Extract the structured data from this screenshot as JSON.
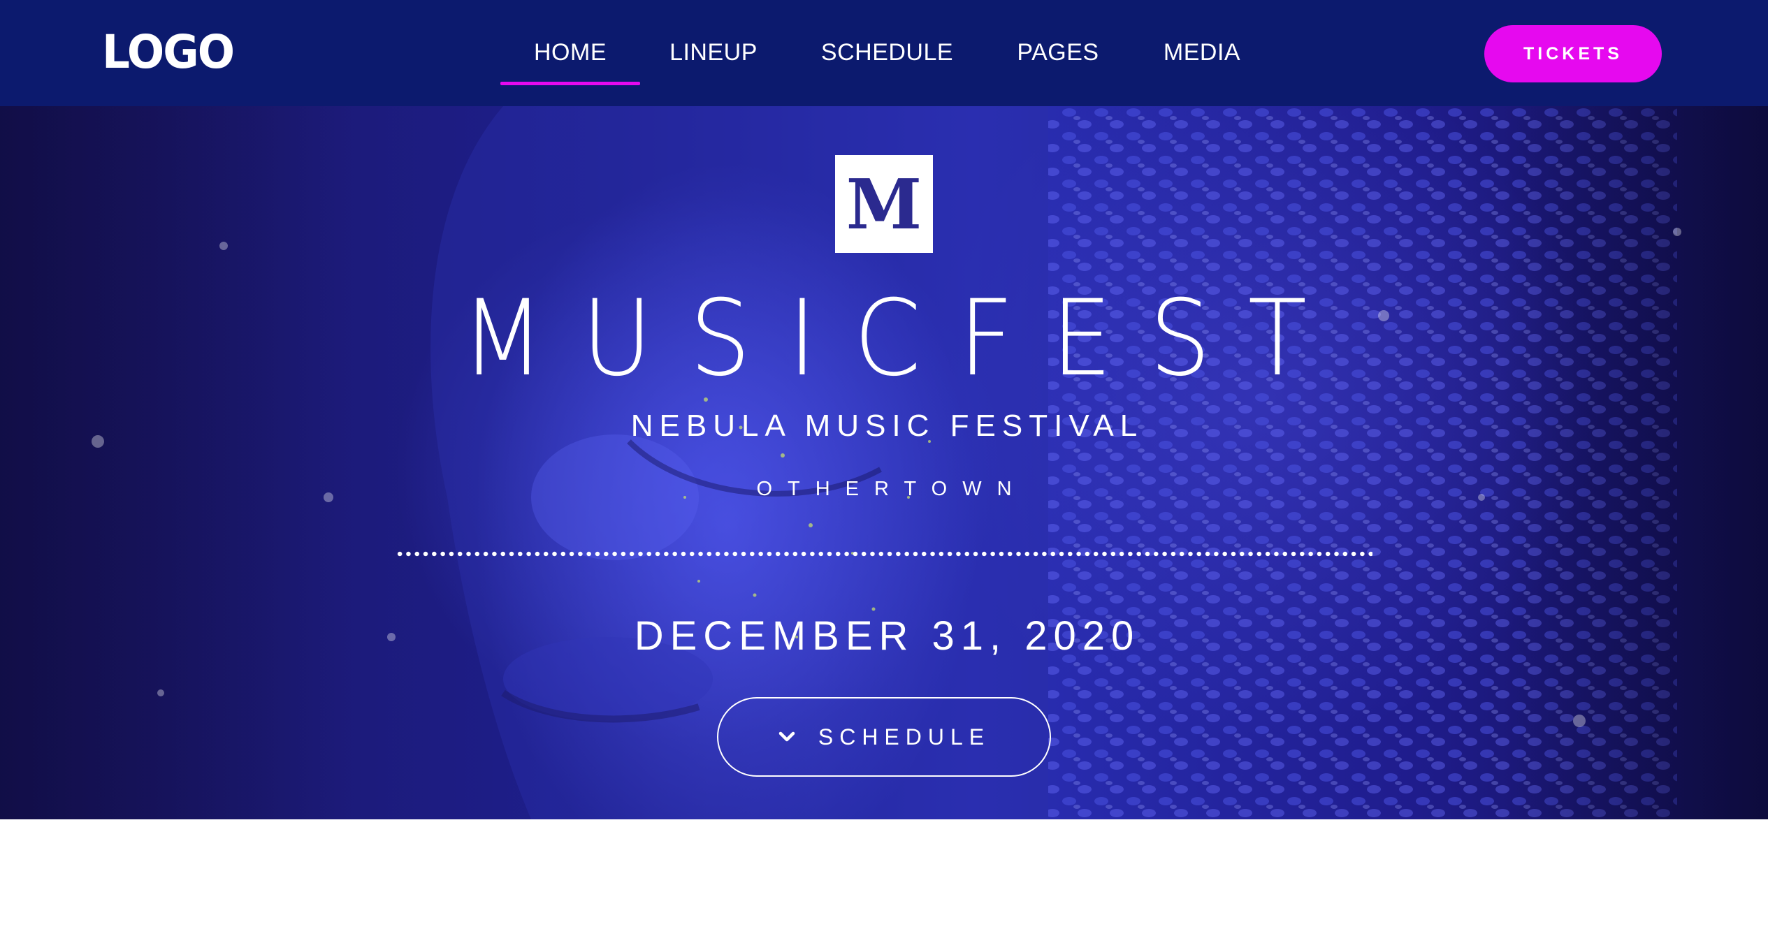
{
  "header": {
    "logo": "LOGO",
    "nav": [
      {
        "label": "HOME",
        "active": true
      },
      {
        "label": "LINEUP",
        "active": false
      },
      {
        "label": "SCHEDULE",
        "active": false
      },
      {
        "label": "PAGES",
        "active": false
      },
      {
        "label": "MEDIA",
        "active": false
      }
    ],
    "tickets_label": "TICKETS"
  },
  "hero": {
    "badge_letter": "M",
    "title": "MUSICFEST",
    "subtitle": "NEBULA MUSIC FESTIVAL",
    "location": "OTHERTOWN",
    "date": "DECEMBER 31, 2020",
    "schedule_button": {
      "label": "SCHEDULE",
      "icon": "chevron-down-icon"
    }
  },
  "colors": {
    "header_bg": "#0c1a6e",
    "accent": "#e609ef",
    "hero_tint": "#2a2fb6",
    "text": "#ffffff"
  }
}
